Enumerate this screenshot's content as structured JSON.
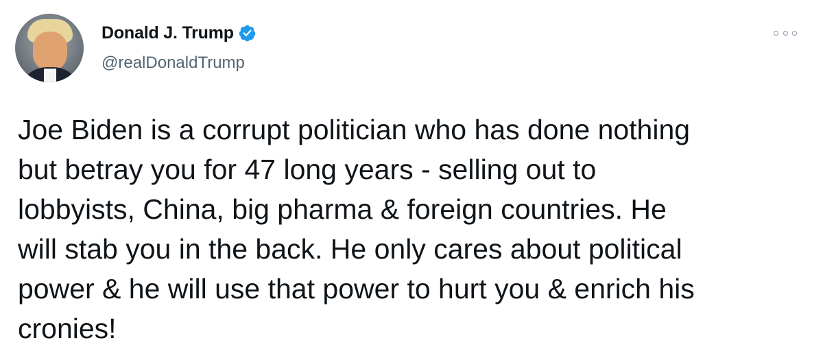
{
  "author": {
    "display_name": "Donald J. Trump",
    "handle": "@realDonaldTrump",
    "verified": true,
    "verified_color": "#1d9bf0"
  },
  "menu": {
    "icon": "more-options-icon"
  },
  "tweet": {
    "lines": [
      "Joe Biden is a corrupt politician who has done nothing",
      "but betray you for 47 long years - selling out to",
      "lobbyists, China, big pharma & foreign countries. He",
      "will stab you in the back. He only cares about political",
      "power & he will use that power to hurt you & enrich his",
      "cronies!"
    ]
  }
}
